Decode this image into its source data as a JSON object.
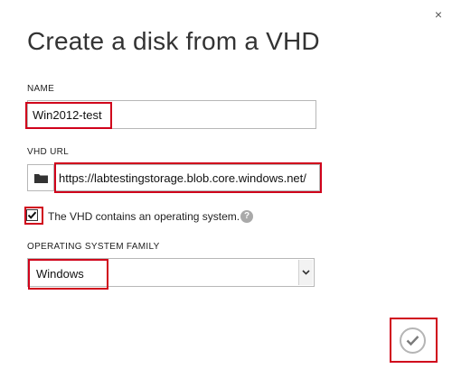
{
  "dialog": {
    "title": "Create a disk from a VHD",
    "close_glyph": "×"
  },
  "name_field": {
    "label": "NAME",
    "value": "Win2012-test"
  },
  "vhd_url_field": {
    "label": "VHD URL",
    "value": "https://labtestingstorage.blob.core.windows.net/",
    "browse_icon": "folder-icon"
  },
  "os_checkbox": {
    "checked": true,
    "label": "The VHD contains an operating system.",
    "help_glyph": "?"
  },
  "os_family": {
    "label": "OPERATING SYSTEM FAMILY",
    "selected": "Windows"
  },
  "footer": {
    "ok_icon": "checkmark-icon"
  },
  "colors": {
    "highlight": "#d0021b",
    "help_icon": "#a9a9a9",
    "ok_border": "#b5b5b5"
  }
}
